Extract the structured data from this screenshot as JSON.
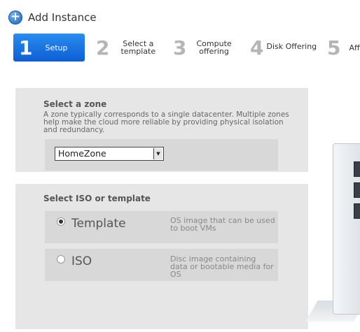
{
  "header": {
    "title": "Add Instance",
    "icon": "plus-circle-icon"
  },
  "steps": [
    {
      "number": "1",
      "label": "Setup"
    },
    {
      "number": "2",
      "label_lines": [
        "Select a",
        "template"
      ]
    },
    {
      "number": "3",
      "label_lines": [
        "Compute",
        "offering"
      ]
    },
    {
      "number": "4",
      "label": "Disk Offering"
    },
    {
      "number": "5",
      "label": "Affi"
    }
  ],
  "zone": {
    "title": "Select a zone",
    "description": "A zone typically corresponds to a single datacenter. Multiple zones help make the cloud more reliable by providing physical isolation and redundancy.",
    "selected": "HomeZone"
  },
  "iso_template": {
    "title": "Select ISO or template",
    "options": [
      {
        "label": "Template",
        "description": "OS image that can be used to boot VMs",
        "checked": true
      },
      {
        "label": "ISO",
        "description": "Disc image containing data or bootable media for OS",
        "checked": false
      }
    ]
  },
  "colors": {
    "accent": "#1f74e6",
    "panel": "#e6e6e6",
    "inner": "#d8d8d8"
  }
}
